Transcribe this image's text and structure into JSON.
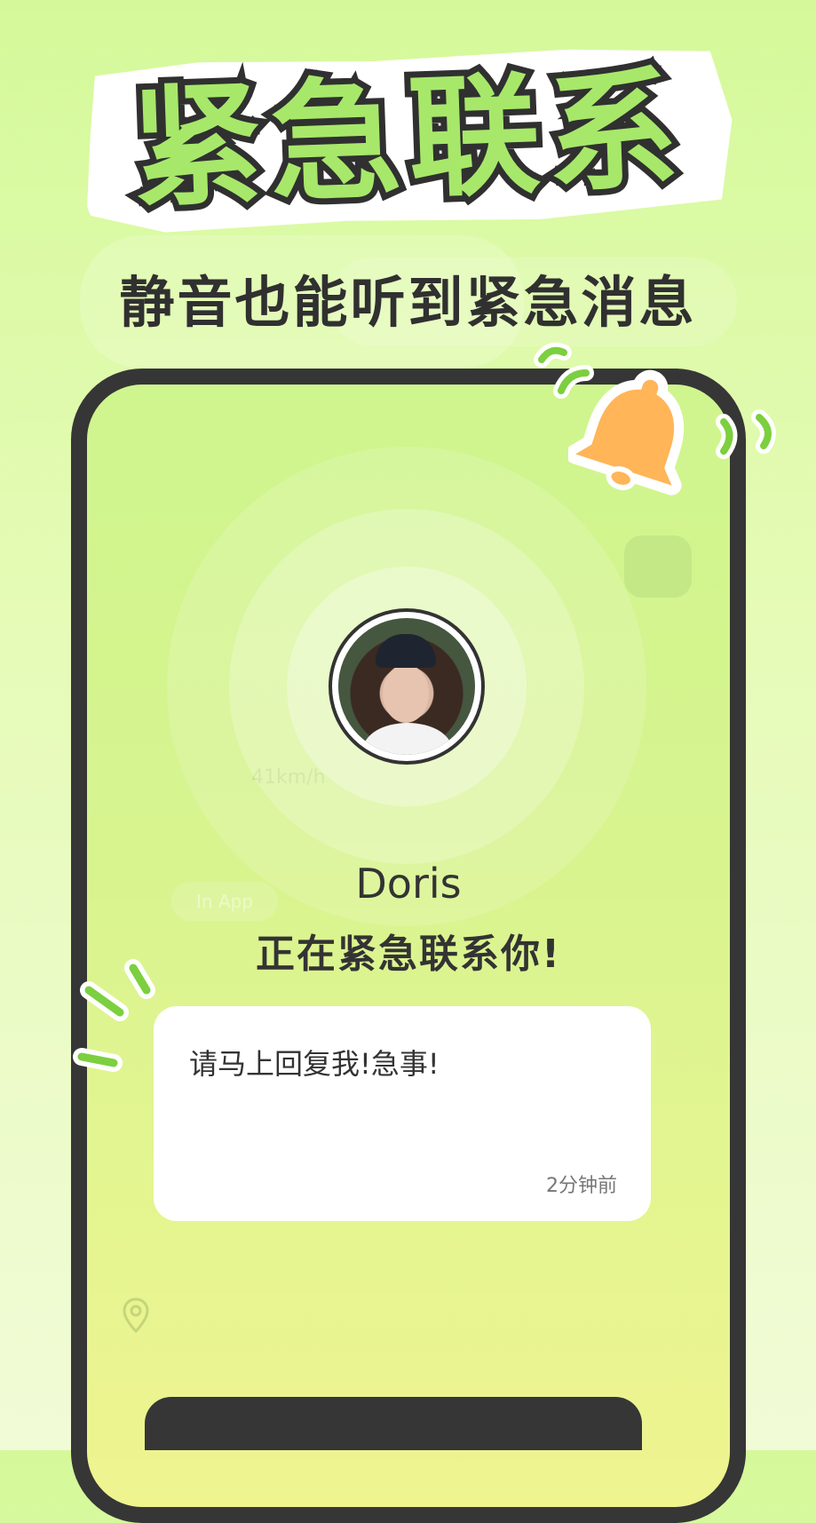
{
  "header": {
    "title": "紧急联系",
    "subtitle": "静音也能听到紧急消息"
  },
  "caller": {
    "name": "Doris",
    "status": "正在紧急联系你!"
  },
  "message": {
    "text": "请马上回复我!急事!",
    "time": "2分钟前"
  },
  "background_hints": {
    "chip_label": "In App",
    "speed_label": "41km/h"
  },
  "icons": {
    "bell": "bell-icon",
    "chat": "chat-bubble-icon",
    "location": "location-pin-icon"
  },
  "colors": {
    "accent_green": "#a7e86a",
    "bell_orange": "#ffb558",
    "outline_dark": "#363636"
  }
}
